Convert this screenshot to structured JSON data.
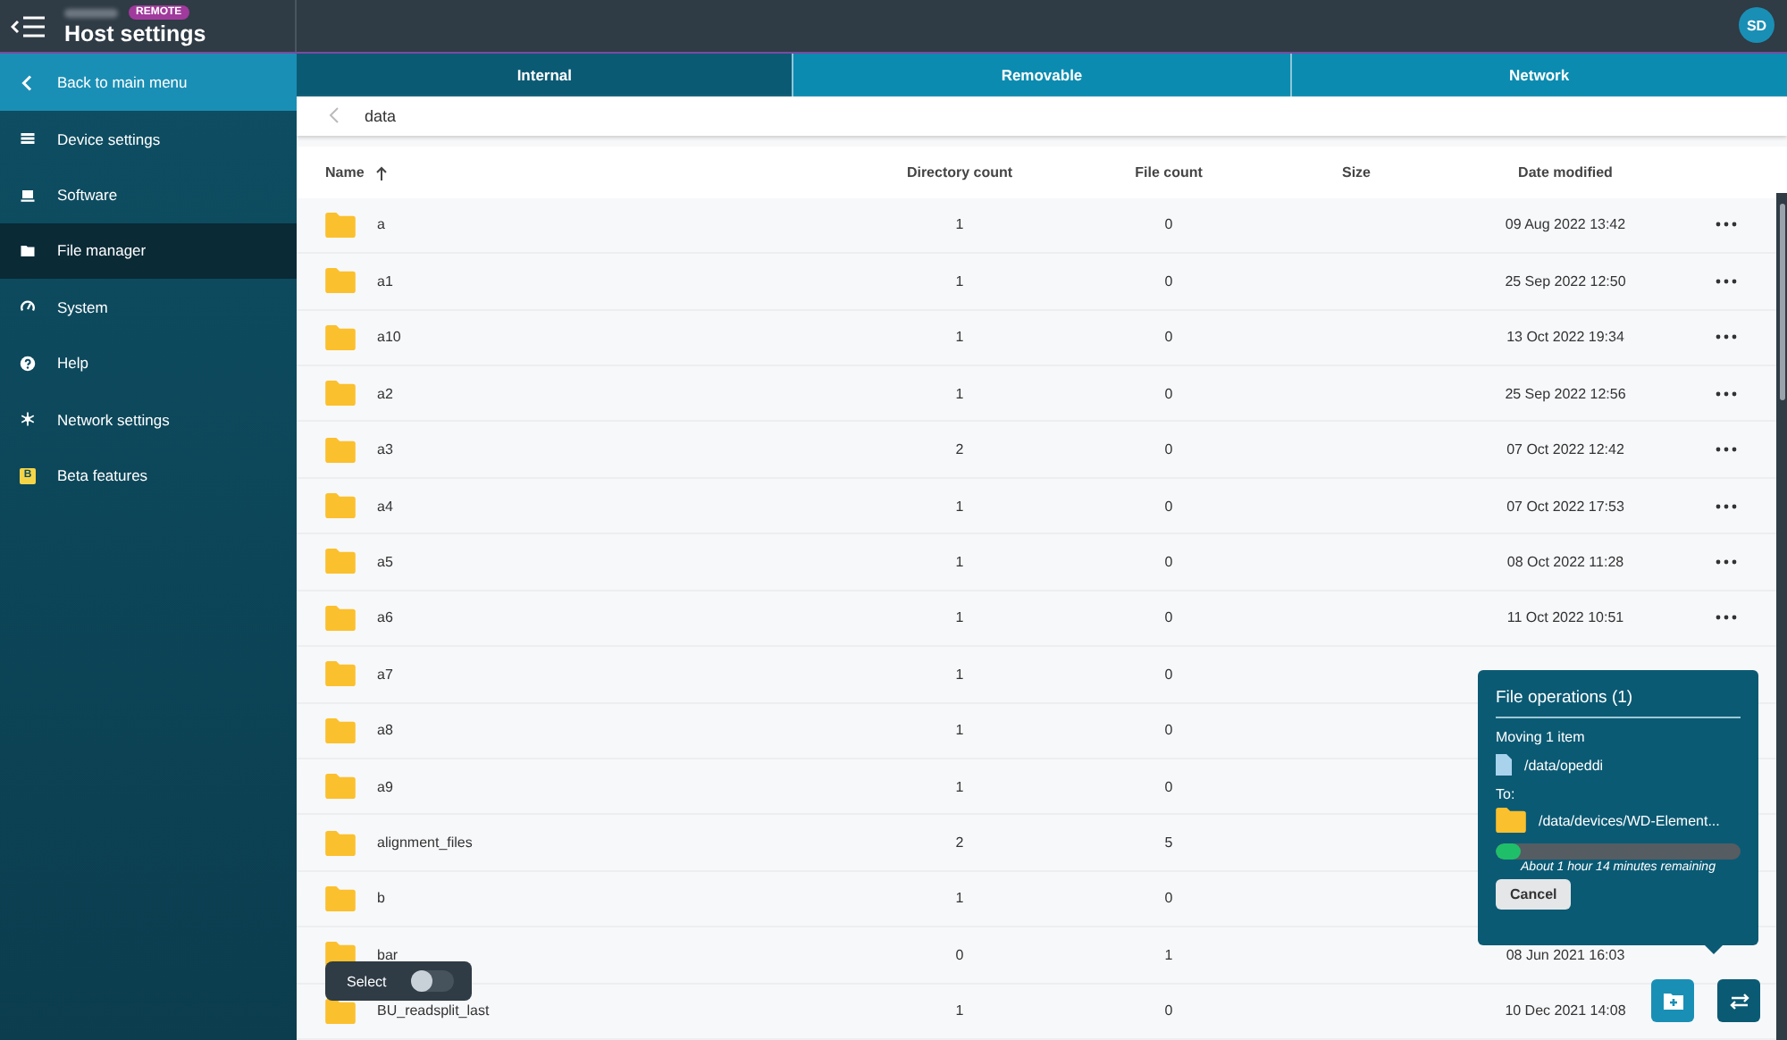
{
  "header": {
    "badge": "REMOTE",
    "title": "Host settings",
    "avatar": "SD"
  },
  "sidebar": {
    "items": [
      {
        "kind": "back",
        "label": "Back to main menu",
        "selected": false
      },
      {
        "kind": "list",
        "label": "Device settings",
        "selected": false
      },
      {
        "kind": "laptop",
        "label": "Software",
        "selected": false
      },
      {
        "kind": "folder",
        "label": "File manager",
        "selected": true
      },
      {
        "kind": "gauge",
        "label": "System",
        "selected": false
      },
      {
        "kind": "help",
        "label": "Help",
        "selected": false
      },
      {
        "kind": "network",
        "label": "Network settings",
        "selected": false
      },
      {
        "kind": "beta",
        "label": "Beta features",
        "selected": false,
        "icon_text": "B"
      }
    ]
  },
  "tabs": [
    {
      "label": "Internal",
      "selected": true
    },
    {
      "label": "Removable",
      "selected": false
    },
    {
      "label": "Network",
      "selected": false
    }
  ],
  "breadcrumb": {
    "path": "data"
  },
  "table": {
    "columns": [
      "Name",
      "Directory count",
      "File count",
      "Size",
      "Date modified"
    ],
    "rows": [
      {
        "name": "a",
        "dirs": "1",
        "files": "0",
        "date": "09 Aug 2022 13:42",
        "menu": true
      },
      {
        "name": "a1",
        "dirs": "1",
        "files": "0",
        "date": "25 Sep 2022 12:50",
        "menu": true
      },
      {
        "name": "a10",
        "dirs": "1",
        "files": "0",
        "date": "13 Oct 2022 19:34",
        "menu": true
      },
      {
        "name": "a2",
        "dirs": "1",
        "files": "0",
        "date": "25 Sep 2022 12:56",
        "menu": true
      },
      {
        "name": "a3",
        "dirs": "2",
        "files": "0",
        "date": "07 Oct 2022 12:42",
        "menu": true
      },
      {
        "name": "a4",
        "dirs": "1",
        "files": "0",
        "date": "07 Oct 2022 17:53",
        "menu": true
      },
      {
        "name": "a5",
        "dirs": "1",
        "files": "0",
        "date": "08 Oct 2022 11:28",
        "menu": true
      },
      {
        "name": "a6",
        "dirs": "1",
        "files": "0",
        "date": "11 Oct 2022 10:51",
        "menu": true
      },
      {
        "name": "a7",
        "dirs": "1",
        "files": "0"
      },
      {
        "name": "a8",
        "dirs": "1",
        "files": "0"
      },
      {
        "name": "a9",
        "dirs": "1",
        "files": "0"
      },
      {
        "name": "alignment_files",
        "dirs": "2",
        "files": "5"
      },
      {
        "name": "b",
        "dirs": "1",
        "files": "0"
      },
      {
        "name": "bar",
        "dirs": "0",
        "files": "1",
        "date": "08 Jun 2021 16:03"
      },
      {
        "name": "BU_readsplit_last",
        "dirs": "1",
        "files": "0",
        "date": "10 Dec 2021 14:08"
      }
    ]
  },
  "select_toggle": {
    "label": "Select",
    "on": false
  },
  "file_operations": {
    "title": "File operations (1)",
    "action": "Moving 1 item",
    "source": "/data/opeddi",
    "to_label": "To:",
    "destination": "/data/devices/WD-Element...",
    "level": 0.1,
    "remaining": "About 1 hour 14 minutes remaining",
    "cancel": "Cancel"
  }
}
